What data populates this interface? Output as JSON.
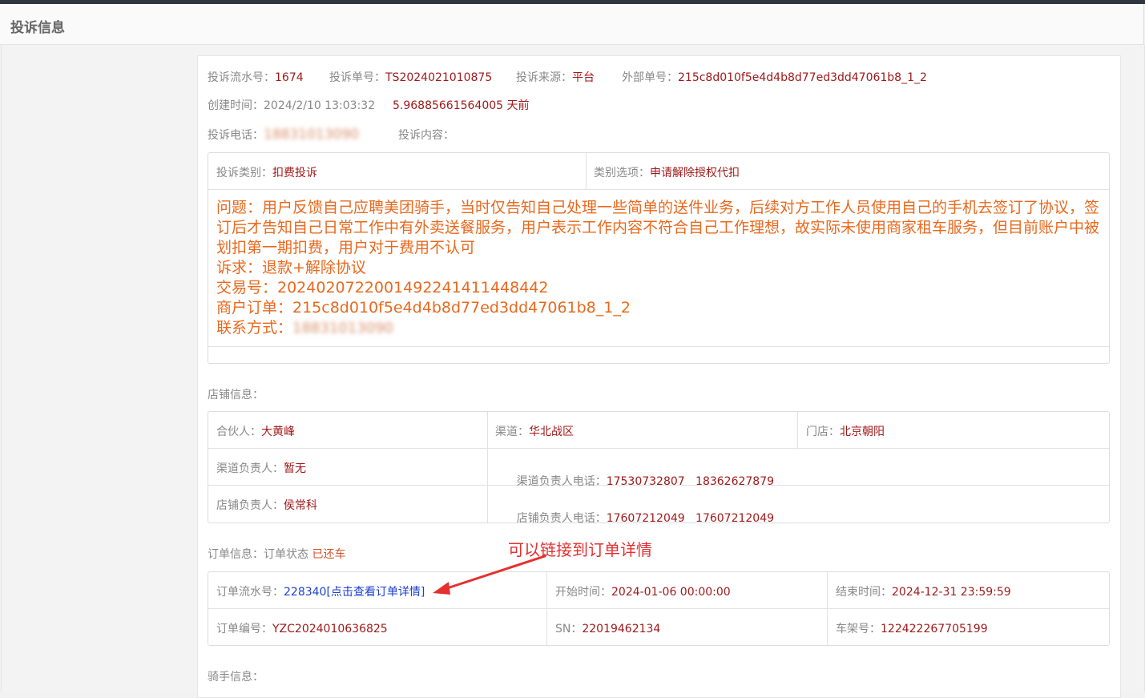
{
  "header": {
    "title": "投诉信息"
  },
  "complaint": {
    "serial_label": "投诉流水号：",
    "serial_value": "1674",
    "no_label": "投诉单号：",
    "no_value": "TS2024021010875",
    "source_label": "投诉来源：",
    "source_value": "平台",
    "external_label": "外部单号：",
    "external_value": "215c8d010f5e4d4b8d77ed3dd47061b8_1_2",
    "created_label": "创建时间：",
    "created_value": "2024/2/10 13:03:32",
    "elapsed": "5.96885661564005 天前",
    "phone_label": "投诉电话：",
    "phone_value": "18831013090",
    "content_label": "投诉内容：",
    "type_label": "投诉类别：",
    "type_value": "扣费投诉",
    "option_label": "类别选项：",
    "option_value": "申请解除授权代扣",
    "text_lines": [
      "问题：用户反馈自己应聘美团骑手，当时仅告知自己处理一些简单的送件业务，后续对方工作人员使用自己的手机去签订了协议，签订后才告知自己日常工作中有外卖送餐服务，用户表示工作内容不符合自己工作理想，故实际未使用商家租车服务，但目前账户中被划扣第一期扣费，用户对于费用不认可",
      "诉求：退款+解除协议",
      "交易号：2024020722001492241411448442",
      "商户订单：215c8d010f5e4d4b8d77ed3dd47061b8_1_2"
    ],
    "contact_label": "联系方式：",
    "contact_value": "18831013090"
  },
  "store": {
    "section_label": "店铺信息：",
    "partner_label": "合伙人：",
    "partner_value": "大黄峰",
    "channel_label": "渠道：",
    "channel_value": "华北战区",
    "shop_label": "门店：",
    "shop_value": "北京朝阳",
    "channel_mgr_label": "渠道负责人：",
    "channel_mgr_value": "暂无",
    "channel_phone_label": "渠道负责人电话：",
    "channel_phone_value": "17530732807   18362627879",
    "shop_mgr_label": "店铺负责人：",
    "shop_mgr_value": "侯常科",
    "shop_phone_label": "店铺负责人电话：",
    "shop_phone_value": "17607212049   17607212049"
  },
  "order": {
    "section_label": "订单信息：",
    "status_label": "订单状态",
    "status_value": "已还车",
    "serial_label": "订单流水号：",
    "serial_value": "228340",
    "detail_link": "[点击查看订单详情]",
    "start_label": "开始时间：",
    "start_value": "2024-01-06 00:00:00",
    "end_label": "结束时间：",
    "end_value": "2024-12-31 23:59:59",
    "no_label": "订单编号：",
    "no_value": "YZC2024010636825",
    "sn_label": "SN：",
    "sn_value": "22019462134",
    "frame_label": "车架号：",
    "frame_value": "122422267705199"
  },
  "rider": {
    "section_label": "骑手信息："
  },
  "annotation": {
    "text": "可以链接到订单详情",
    "color": "#e53030"
  }
}
